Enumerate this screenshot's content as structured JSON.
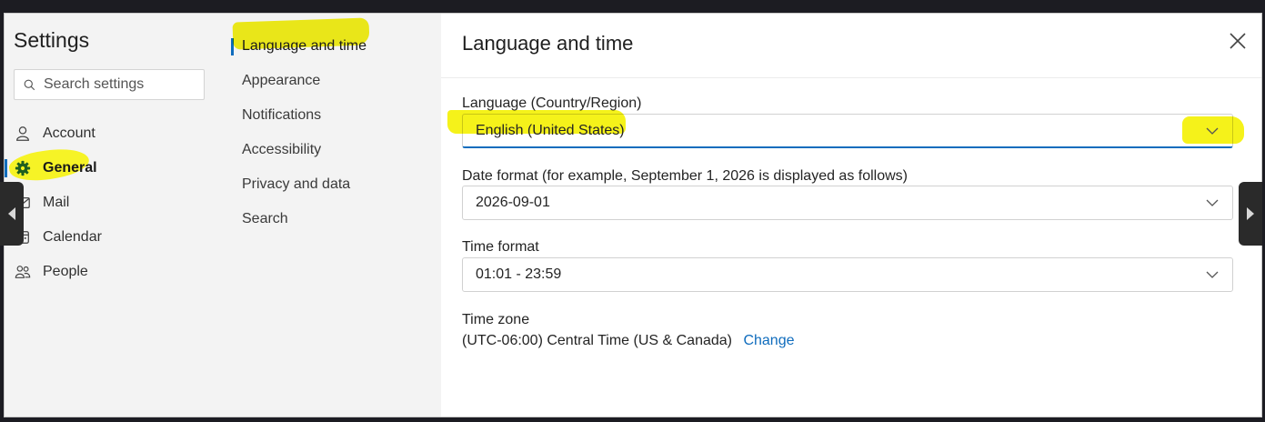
{
  "sidebar": {
    "title": "Settings",
    "search_placeholder": "Search settings",
    "items": [
      {
        "label": "Account",
        "icon": "person-icon"
      },
      {
        "label": "General",
        "icon": "gear-icon"
      },
      {
        "label": "Mail",
        "icon": "mail-icon"
      },
      {
        "label": "Calendar",
        "icon": "calendar-icon"
      },
      {
        "label": "People",
        "icon": "people-icon"
      }
    ]
  },
  "subnav": {
    "items": [
      {
        "label": "Language and time"
      },
      {
        "label": "Appearance"
      },
      {
        "label": "Notifications"
      },
      {
        "label": "Accessibility"
      },
      {
        "label": "Privacy and data"
      },
      {
        "label": "Search"
      }
    ]
  },
  "panel": {
    "title": "Language and time",
    "language_label": "Language (Country/Region)",
    "language_value": "English (United States)",
    "date_label": "Date format (for example, September 1, 2026 is displayed as follows)",
    "date_value": "2026-09-01",
    "time_label": "Time format",
    "time_value": "01:01 - 23:59",
    "timezone_label": "Time zone",
    "timezone_value": "(UTC-06:00) Central Time (US & Canada)",
    "timezone_change": "Change"
  },
  "colors": {
    "accent": "#0f6cbd",
    "highlight": "#f5f21a",
    "general_icon": "#1f5f1f"
  }
}
